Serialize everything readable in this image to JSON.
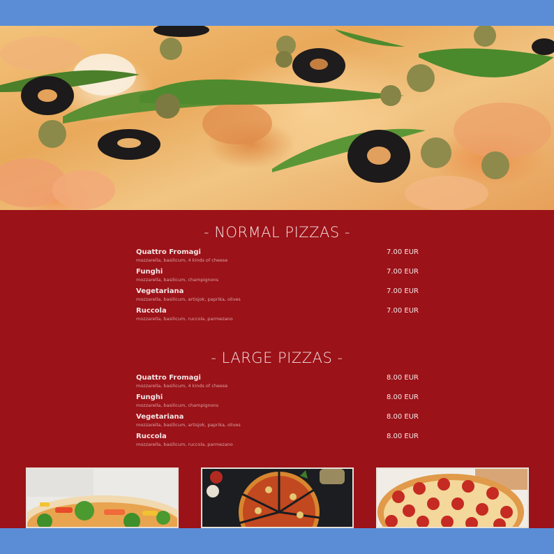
{
  "hero": {
    "image": "pizza-closeup-image"
  },
  "sections": [
    {
      "title": "- NORMAL PIZZAS -",
      "items": [
        {
          "name": "Quattro Fromagi",
          "desc": "mozzarella, basilicum, 4 kinds of cheese",
          "price": "7.00 EUR"
        },
        {
          "name": "Funghi",
          "desc": "mozzarella, basilicum, champignons",
          "price": "7.00 EUR"
        },
        {
          "name": "Vegetariana",
          "desc": "mozzarella, basilicum, artisjok, paprika, olives",
          "price": "7.00 EUR"
        },
        {
          "name": "Ruccola",
          "desc": "mozzarella, basilicum, ruccola, parmezano",
          "price": "7.00 EUR"
        }
      ]
    },
    {
      "title": "- LARGE PIZZAS -",
      "items": [
        {
          "name": "Quattro Fromagi",
          "desc": "mozzarella, basilicum, 4 kinds of cheese",
          "price": "8.00 EUR"
        },
        {
          "name": "Funghi",
          "desc": "mozzarella, basilicum, champignons",
          "price": "8.00 EUR"
        },
        {
          "name": "Vegetariana",
          "desc": "mozzarella, basilicum, artisjok, paprika, olives",
          "price": "8.00 EUR"
        },
        {
          "name": "Ruccola",
          "desc": "mozzarella, basilicum, ruccola, parmezano",
          "price": "8.00 EUR"
        }
      ]
    }
  ],
  "gallery": [
    "vegetable-pizza-photo",
    "sliced-pizza-photo",
    "pepperoni-pizza-photo"
  ],
  "colors": {
    "frame": "#5b8dd6",
    "menu_bg": "#9b1218",
    "text": "#f5e6e6"
  }
}
